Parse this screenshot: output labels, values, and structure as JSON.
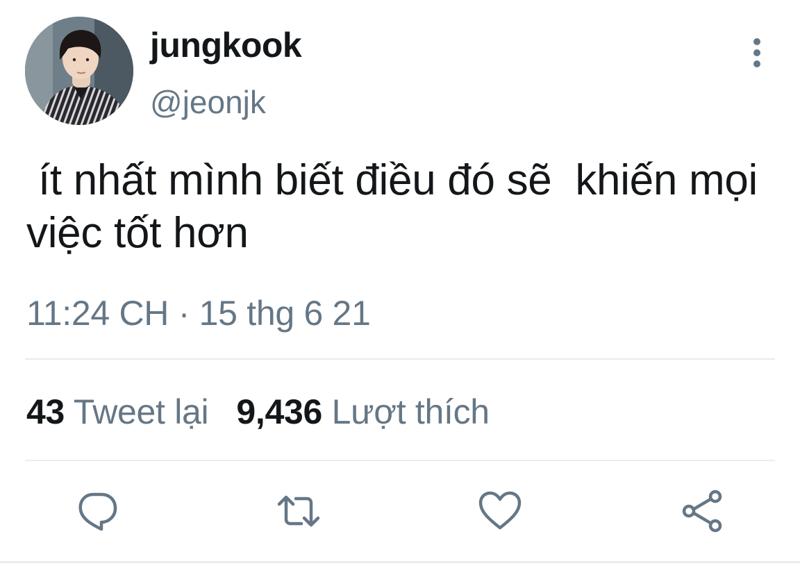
{
  "author": {
    "display_name": "jungkook",
    "handle": "@jeonjk"
  },
  "tweet": {
    "text": " ít nhất mình biết điều đó sẽ  khiến mọi việc tốt hơn",
    "timestamp": "11:24 CH · 15 thg 6 21"
  },
  "stats": {
    "retweets_count": "43",
    "retweets_label": "Tweet lại",
    "likes_count": "9,436",
    "likes_label": "Lượt thích"
  },
  "actions": [
    {
      "name": "reply",
      "icon": "reply-icon"
    },
    {
      "name": "retweet",
      "icon": "retweet-icon"
    },
    {
      "name": "like",
      "icon": "heart-icon"
    },
    {
      "name": "share",
      "icon": "share-icon"
    }
  ],
  "colors": {
    "text_primary": "#14171a",
    "text_secondary": "#657786",
    "divider": "#e6ecf0",
    "icon": "#657786"
  }
}
